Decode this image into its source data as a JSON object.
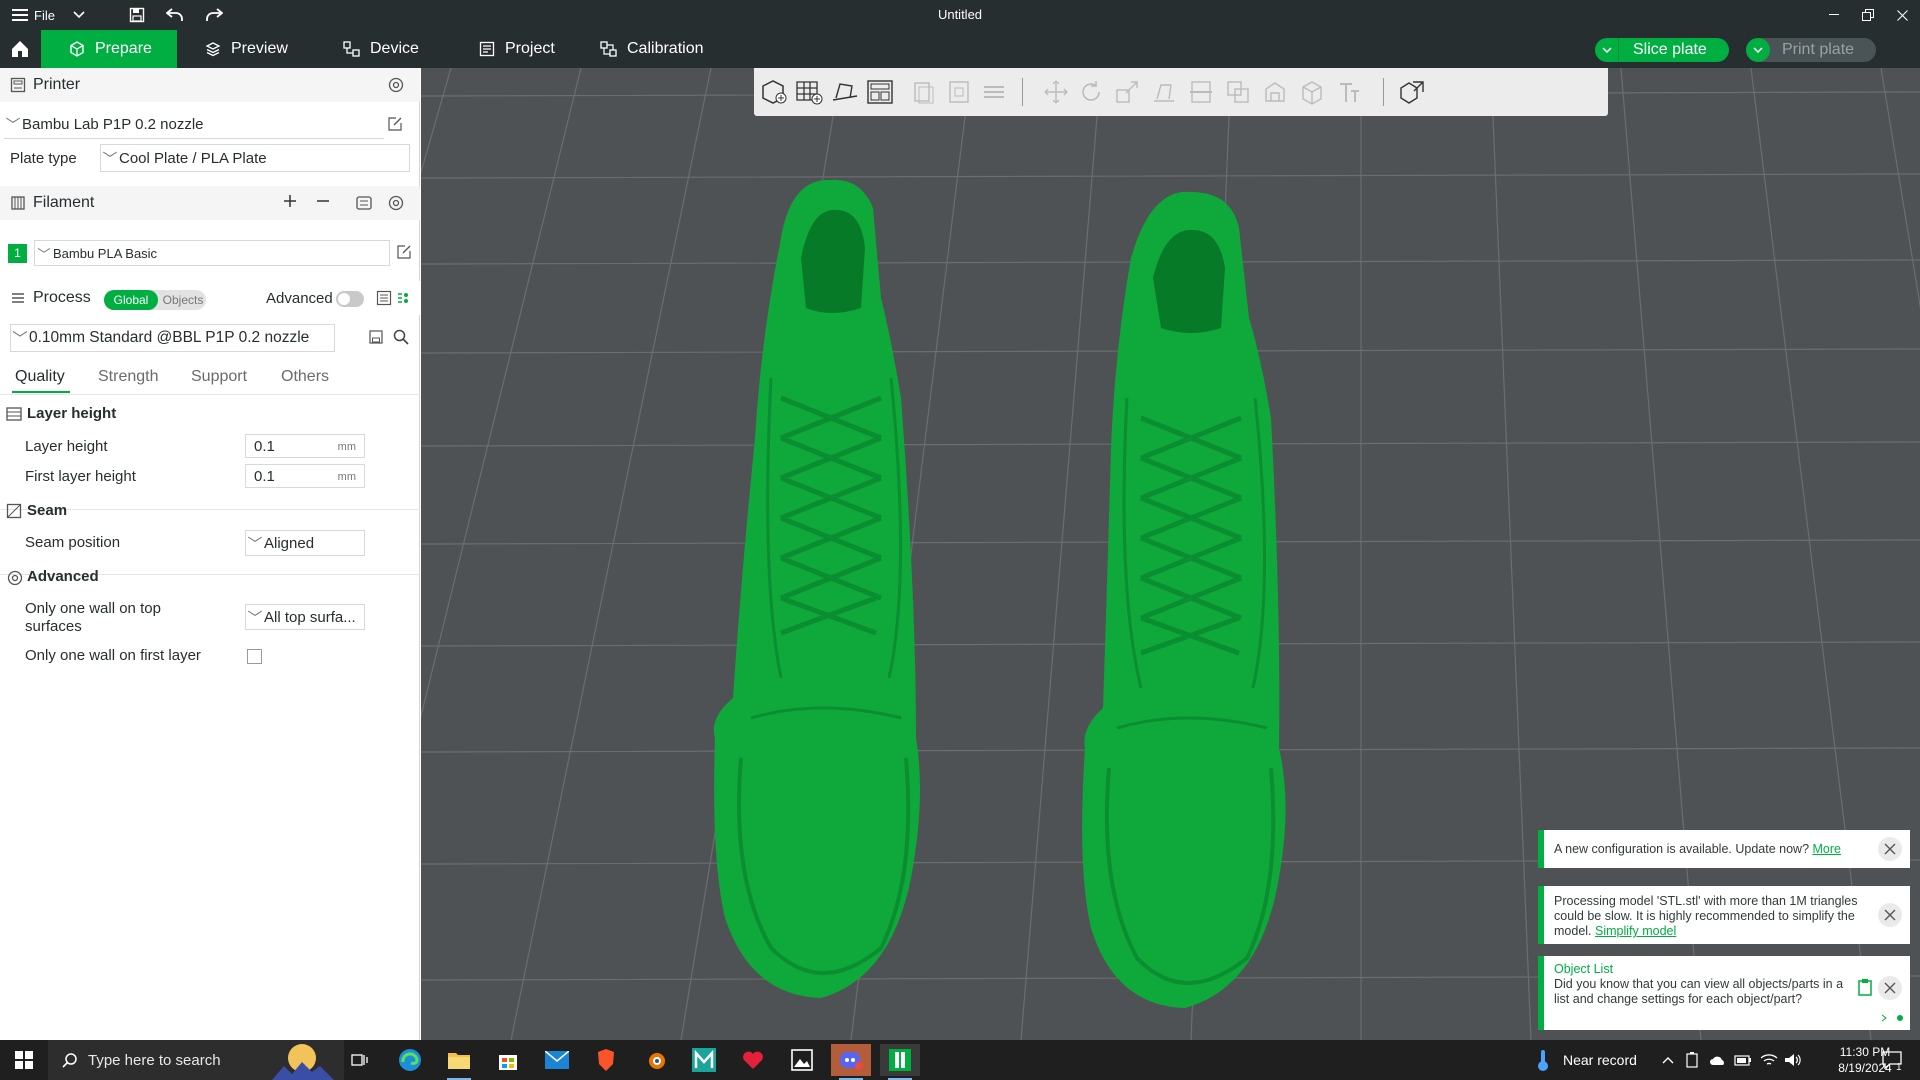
{
  "app": {
    "window_title": "Untitled",
    "file_menu_label": "File"
  },
  "tabs": [
    {
      "label": "Prepare",
      "icon": "cube-icon"
    },
    {
      "label": "Preview",
      "icon": "layers-icon"
    },
    {
      "label": "Device",
      "icon": "device-icon"
    },
    {
      "label": "Project",
      "icon": "project-icon"
    },
    {
      "label": "Calibration",
      "icon": "calibration-icon"
    }
  ],
  "actions": {
    "slice_label": "Slice plate",
    "print_label": "Print plate"
  },
  "printer": {
    "section_title": "Printer",
    "name": "Bambu Lab P1P 0.2 nozzle",
    "plate_type_label": "Plate type",
    "plate_type_value": "Cool Plate / PLA Plate"
  },
  "filament": {
    "section_title": "Filament",
    "slots": [
      {
        "index": "1",
        "name": "Bambu PLA Basic",
        "color": "#00ae42"
      }
    ]
  },
  "process": {
    "section_title": "Process",
    "toggle_global": "Global",
    "toggle_objects": "Objects",
    "advanced_label": "Advanced",
    "advanced_enabled": false,
    "preset": "0.10mm Standard @BBL P1P 0.2 nozzle",
    "subtabs": [
      "Quality",
      "Strength",
      "Support",
      "Others"
    ],
    "active_subtab": "Quality",
    "groups": {
      "layer_height": {
        "title": "Layer height",
        "layer_height_label": "Layer height",
        "layer_height_value": "0.1",
        "first_layer_label": "First layer height",
        "first_layer_value": "0.1",
        "unit": "mm"
      },
      "seam": {
        "title": "Seam",
        "position_label": "Seam position",
        "position_value": "Aligned"
      },
      "advanced": {
        "title": "Advanced",
        "top_wall_label_1": "Only one wall on top",
        "top_wall_label_2": "surfaces",
        "top_wall_value": "All top surfa...",
        "first_layer_wall_label": "Only one wall on first layer",
        "first_layer_wall_checked": false
      }
    }
  },
  "notifications": [
    {
      "text": "A new configuration is available. Update now?",
      "link": "More"
    },
    {
      "text": "Processing model 'STL.stl' with more than 1M triangles could be slow. It is highly recommended to simplify the model.",
      "link": "Simplify model"
    },
    {
      "title": "Object List",
      "text": "Did you know that you can view all objects/parts in a list and change settings for each object/part?"
    }
  ],
  "taskbar": {
    "search_placeholder": "Type here to search",
    "weather": "Near record",
    "time": "11:30 PM",
    "date": "8/19/2024",
    "notification_count": "1"
  },
  "colors": {
    "accent": "#00ae42",
    "dark": "#262e30",
    "viewport": "#4e5254",
    "model": "#0fa83a"
  }
}
